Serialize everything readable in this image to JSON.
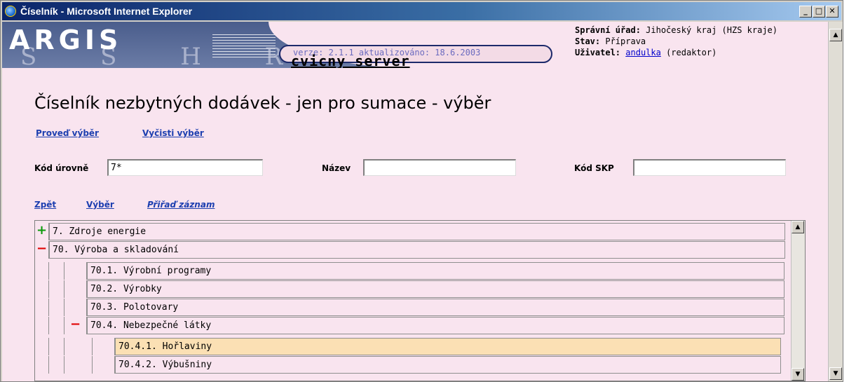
{
  "window": {
    "title": "Číselník - Microsoft Internet Explorer",
    "minimize": "_",
    "maximize": "□",
    "close": "✕"
  },
  "header": {
    "logo": "ARGIS",
    "logo_sub": "S  S  H  R",
    "version": "verze: 2.1.1  aktualizováno: 18.6.2003",
    "server": "cvicny server",
    "office_label": "Správní úřad:",
    "office_value": "Jihočeský kraj (HZS kraje)",
    "state_label": "Stav:",
    "state_value": "Příprava",
    "user_label": "Uživatel:",
    "user_name": "andulka",
    "user_role": "(redaktor)"
  },
  "page": {
    "title": "Číselník nezbytných dodávek - jen pro sumace - výběr"
  },
  "actions": {
    "do_select": "Proveď výběr",
    "clear_select": "Vyčisti výběr"
  },
  "filters": {
    "level_code_label": "Kód úrovně",
    "level_code_value": "7*",
    "name_label": "Název",
    "name_value": "",
    "skp_label": "Kód SKP",
    "skp_value": ""
  },
  "nav": {
    "back": "Zpět",
    "select": "Výběr",
    "assign": "Přiřaď záznam"
  },
  "tree": {
    "rows": [
      {
        "toggle": "+",
        "label": "7.  Zdroje energie"
      },
      {
        "toggle": "−",
        "label": "70.  Výroba a skladování"
      },
      {
        "toggle": "",
        "label": "70.1.  Výrobní programy"
      },
      {
        "toggle": "",
        "label": "70.2.  Výrobky"
      },
      {
        "toggle": "",
        "label": "70.3.  Polotovary"
      },
      {
        "toggle": "−",
        "label": "70.4.  Nebezpečné látky"
      },
      {
        "toggle": "",
        "label": "70.4.1.  Hořlaviny"
      },
      {
        "toggle": "",
        "label": "70.4.2.  Výbušniny"
      }
    ]
  },
  "icons": {
    "scroll_up": "▲",
    "scroll_down": "▼"
  }
}
